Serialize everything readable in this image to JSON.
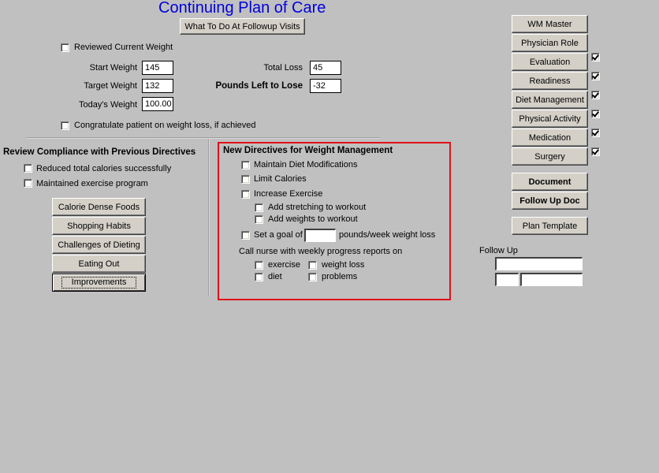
{
  "header": {
    "title": "Continuing Plan of Care",
    "followup_visits_button": "What To Do At Followup Visits"
  },
  "weight": {
    "reviewed_current_weight": {
      "label": "Reviewed Current Weight",
      "checked": false
    },
    "start_weight": {
      "label": "Start Weight",
      "value": "145"
    },
    "target_weight": {
      "label": "Target Weight",
      "value": "132"
    },
    "todays_weight": {
      "label": "Today's Weight",
      "value": "100.00"
    },
    "total_loss": {
      "label": "Total Loss",
      "value": "45"
    },
    "pounds_left": {
      "label": "Pounds Left to Lose",
      "value": "-32"
    },
    "congratulate": {
      "label": "Congratulate patient on weight loss, if achieved",
      "checked": false
    }
  },
  "compliance": {
    "heading": "Review Compliance with Previous Directives",
    "items": [
      {
        "label": "Reduced total calories successfully",
        "checked": false
      },
      {
        "label": "Maintained exercise program",
        "checked": false
      }
    ],
    "buttons": [
      "Calorie Dense Foods",
      "Shopping Habits",
      "Challenges of Dieting",
      "Eating Out",
      "Improvements"
    ]
  },
  "directives": {
    "heading": "New Directives for Weight Management",
    "items": [
      {
        "label": "Maintain Diet Modifications",
        "checked": false
      },
      {
        "label": "Limit Calories",
        "checked": false
      },
      {
        "label": "Increase Exercise",
        "checked": false
      }
    ],
    "sub_items": [
      {
        "label": "Add stretching to workout",
        "checked": false
      },
      {
        "label": "Add weights to workout",
        "checked": false
      }
    ],
    "goal": {
      "prefix": "Set a goal of",
      "value": "",
      "suffix": "pounds/week weight loss",
      "checked": false
    },
    "call_nurse": {
      "label": "Call nurse with weekly progress reports on",
      "options": [
        {
          "label": "exercise",
          "checked": false
        },
        {
          "label": "weight loss",
          "checked": false
        },
        {
          "label": "diet",
          "checked": false
        },
        {
          "label": "problems",
          "checked": false
        }
      ]
    },
    "accent_color": "#e0101a"
  },
  "nav": {
    "buttons": [
      {
        "label": "WM Master"
      },
      {
        "label": "Physician Role"
      },
      {
        "label": "Evaluation",
        "checked": true
      },
      {
        "label": "Readiness",
        "checked": true
      },
      {
        "label": "Diet Management",
        "checked": true
      },
      {
        "label": "Physical Activity",
        "checked": true
      },
      {
        "label": "Medication",
        "checked": true
      },
      {
        "label": "Surgery",
        "checked": true
      }
    ],
    "document": "Document",
    "follow_up_doc": "Follow Up Doc",
    "plan_template": "Plan Template"
  },
  "follow_up": {
    "label": "Follow Up",
    "field1": "",
    "field2": "",
    "field3": ""
  }
}
